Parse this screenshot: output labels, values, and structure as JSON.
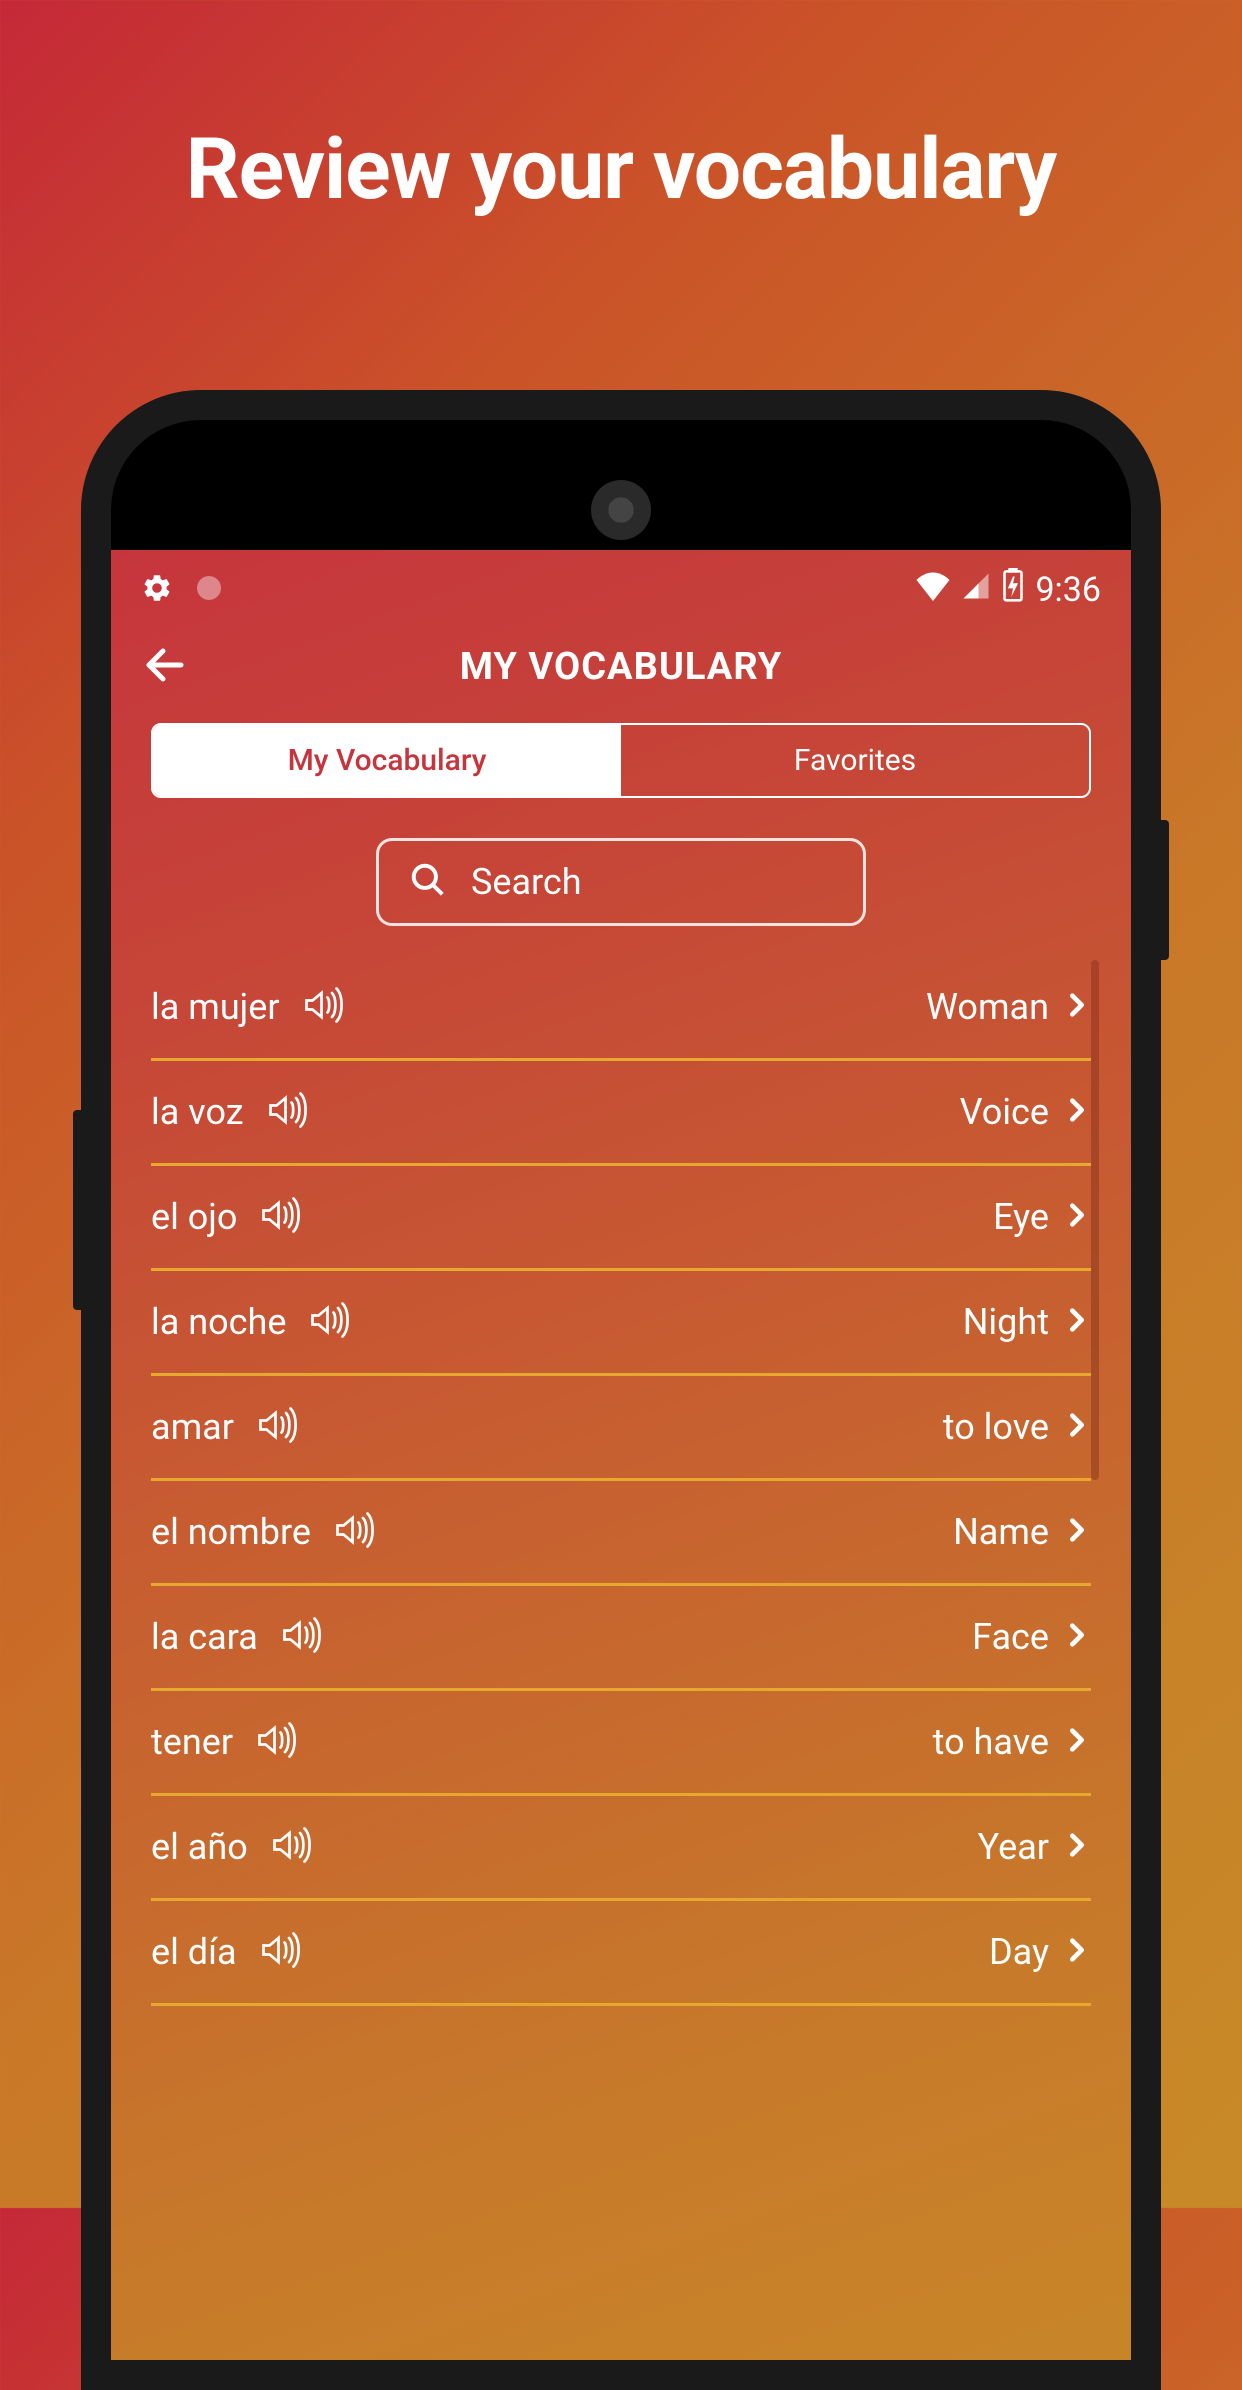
{
  "headline": "Review your vocabulary",
  "status": {
    "time": "9:36"
  },
  "header": {
    "title": "MY VOCABULARY"
  },
  "tabs": {
    "vocab": "My Vocabulary",
    "favorites": "Favorites"
  },
  "search": {
    "placeholder": "Search"
  },
  "words": [
    {
      "native": "la mujer",
      "translation": "Woman"
    },
    {
      "native": "la voz",
      "translation": "Voice"
    },
    {
      "native": "el ojo",
      "translation": "Eye"
    },
    {
      "native": "la noche",
      "translation": "Night"
    },
    {
      "native": "amar",
      "translation": "to love"
    },
    {
      "native": "el nombre",
      "translation": "Name"
    },
    {
      "native": "la cara",
      "translation": "Face"
    },
    {
      "native": "tener",
      "translation": "to have"
    },
    {
      "native": "el año",
      "translation": "Year"
    },
    {
      "native": "el día",
      "translation": "Day"
    }
  ]
}
